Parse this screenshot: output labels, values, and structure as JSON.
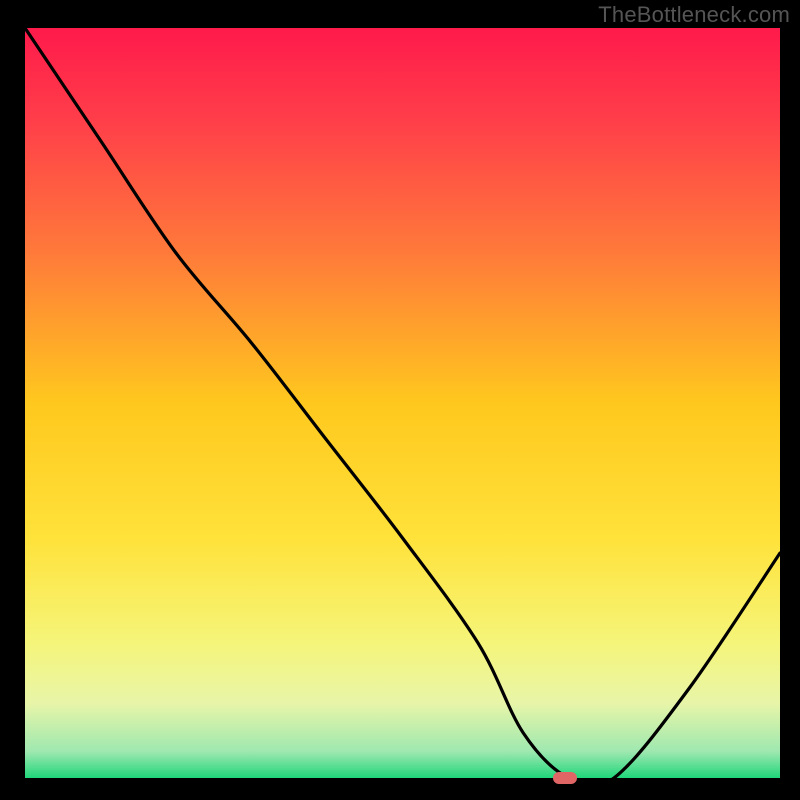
{
  "watermark": "TheBottleneck.com",
  "chart_data": {
    "type": "line",
    "title": "",
    "xlabel": "",
    "ylabel": "",
    "xlim": [
      0,
      1
    ],
    "ylim": [
      0,
      1
    ],
    "series": [
      {
        "name": "curve",
        "x": [
          0.0,
          0.1,
          0.2,
          0.3,
          0.4,
          0.5,
          0.6,
          0.66,
          0.72,
          0.78,
          0.88,
          1.0
        ],
        "y": [
          1.0,
          0.85,
          0.7,
          0.58,
          0.45,
          0.32,
          0.18,
          0.06,
          0.0,
          0.0,
          0.12,
          0.3
        ]
      }
    ],
    "marker": {
      "x": 0.715,
      "y": 0.0
    },
    "gradient_stops": [
      {
        "offset": 0.0,
        "color": "#ff1a4b"
      },
      {
        "offset": 0.12,
        "color": "#ff3d4a"
      },
      {
        "offset": 0.3,
        "color": "#ff7a3a"
      },
      {
        "offset": 0.5,
        "color": "#ffc81e"
      },
      {
        "offset": 0.68,
        "color": "#ffe23a"
      },
      {
        "offset": 0.82,
        "color": "#f5f57a"
      },
      {
        "offset": 0.9,
        "color": "#e8f5a8"
      },
      {
        "offset": 0.965,
        "color": "#9ee8b0"
      },
      {
        "offset": 1.0,
        "color": "#1fd67a"
      }
    ]
  }
}
